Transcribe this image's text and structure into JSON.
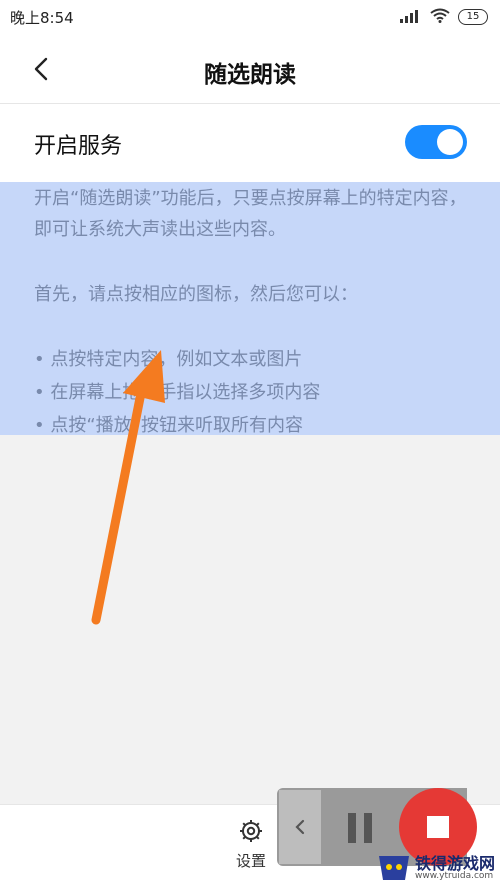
{
  "status_bar": {
    "time": "晚上8:54",
    "battery": "15"
  },
  "header": {
    "title": "随选朗读",
    "back_icon": "chevron-left-icon"
  },
  "service": {
    "label": "开启服务",
    "enabled": true,
    "accent_color": "#1a8cff"
  },
  "description": {
    "paragraph1": "开启“随选朗读”功能后，只要点按屏幕上的特定内容，即可让系统大声读出这些内容。",
    "paragraph2": "首先，请点按相应的图标，然后您可以：",
    "items": [
      "点按特定内容，例如文本或图片",
      "在屏幕上拖动手指以选择多项内容",
      "点按“播放”按钮来听取所有内容"
    ]
  },
  "bottom_bar": {
    "settings_label": "设置",
    "settings_icon": "gear-icon"
  },
  "floating_controls": {
    "collapse_icon": "chevron-left-icon",
    "pause_icon": "pause-icon",
    "stop_icon": "stop-icon",
    "stop_color": "#e53935"
  },
  "watermark": {
    "name": "铁得游戏网",
    "url": "www.ytruida.com"
  },
  "annotation": {
    "arrow_color": "#f47b20"
  }
}
